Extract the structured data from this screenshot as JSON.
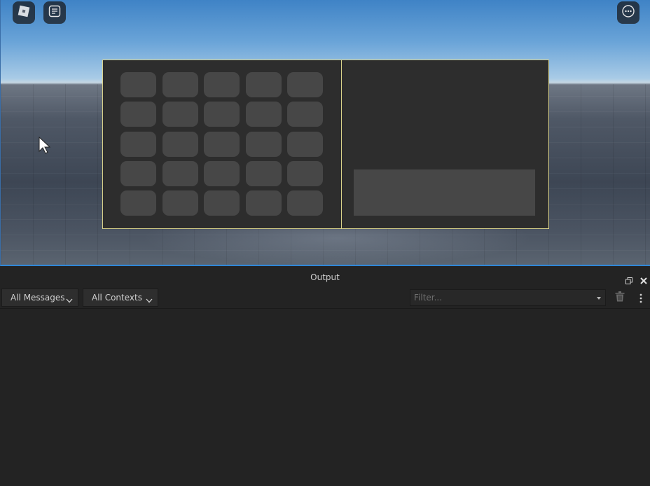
{
  "viewport": {
    "icons": [
      "roblox-menu-icon",
      "chat-icon",
      "more-options-icon",
      "mouse-cursor-icon"
    ],
    "inventory": {
      "grid_rows": 5,
      "grid_cols": 5
    }
  },
  "output": {
    "title": "Output",
    "message_filter": "All Messages",
    "context_filter": "All Contexts",
    "filter_placeholder": "Filter..."
  },
  "colors": {
    "panel_border": "#d9d28a",
    "panel_bg": "#2d2d2d",
    "slot": "#474747",
    "output_bg": "#232323",
    "viewport_border": "#2f87d8"
  }
}
